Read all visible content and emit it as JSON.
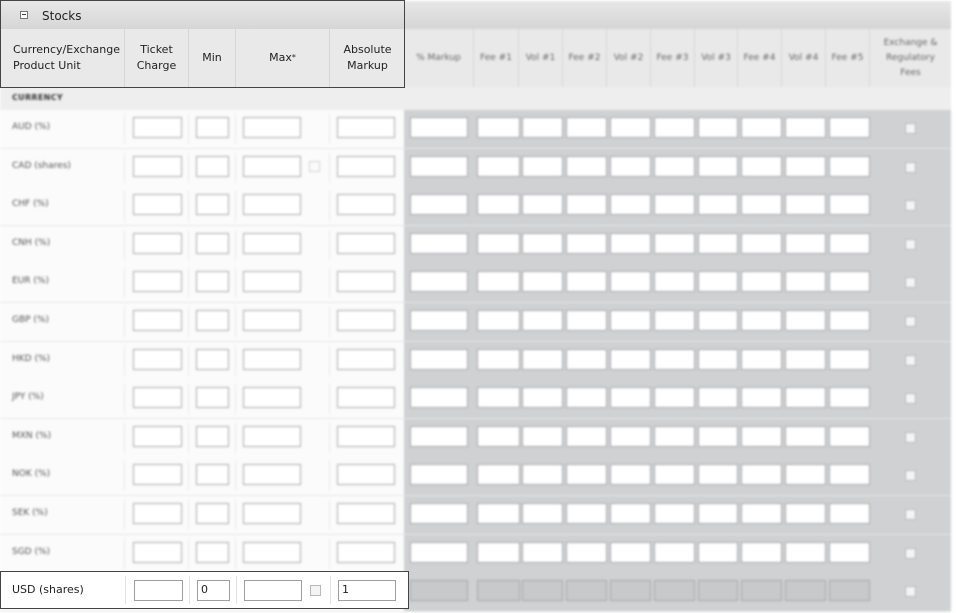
{
  "panel": {
    "title": "Stocks",
    "section_label": "CURRENCY"
  },
  "columns": {
    "currency": "Currency/Exchange Product Unit",
    "ticket": "Ticket Charge",
    "min": "Min",
    "max": "Max",
    "max_mark": "*",
    "absolute": "Absolute Markup",
    "percent": "% Markup",
    "fee1": "Fee #1",
    "vol1": "Vol #1",
    "fee2": "Fee #2",
    "vol2": "Vol #2",
    "fee3": "Fee #3",
    "vol3": "Vol #3",
    "fee4": "Fee #4",
    "vol4": "Vol #4",
    "fee5": "Fee #5",
    "exchange": "Exchange & Regulatory Fees"
  },
  "rows": [
    {
      "label": "AUD (%)"
    },
    {
      "label": "CAD (shares)"
    },
    {
      "label": "CHF (%)"
    },
    {
      "label": "CNH (%)"
    },
    {
      "label": "EUR (%)"
    },
    {
      "label": "GBP (%)"
    },
    {
      "label": "HKD (%)"
    },
    {
      "label": "JPY (%)"
    },
    {
      "label": "MXN (%)"
    },
    {
      "label": "NOK (%)"
    },
    {
      "label": "SEK (%)"
    },
    {
      "label": "SGD (%)"
    }
  ],
  "usd_row": {
    "label": "USD (shares)",
    "ticket": "",
    "min": "0",
    "max": "",
    "absolute": "1"
  }
}
